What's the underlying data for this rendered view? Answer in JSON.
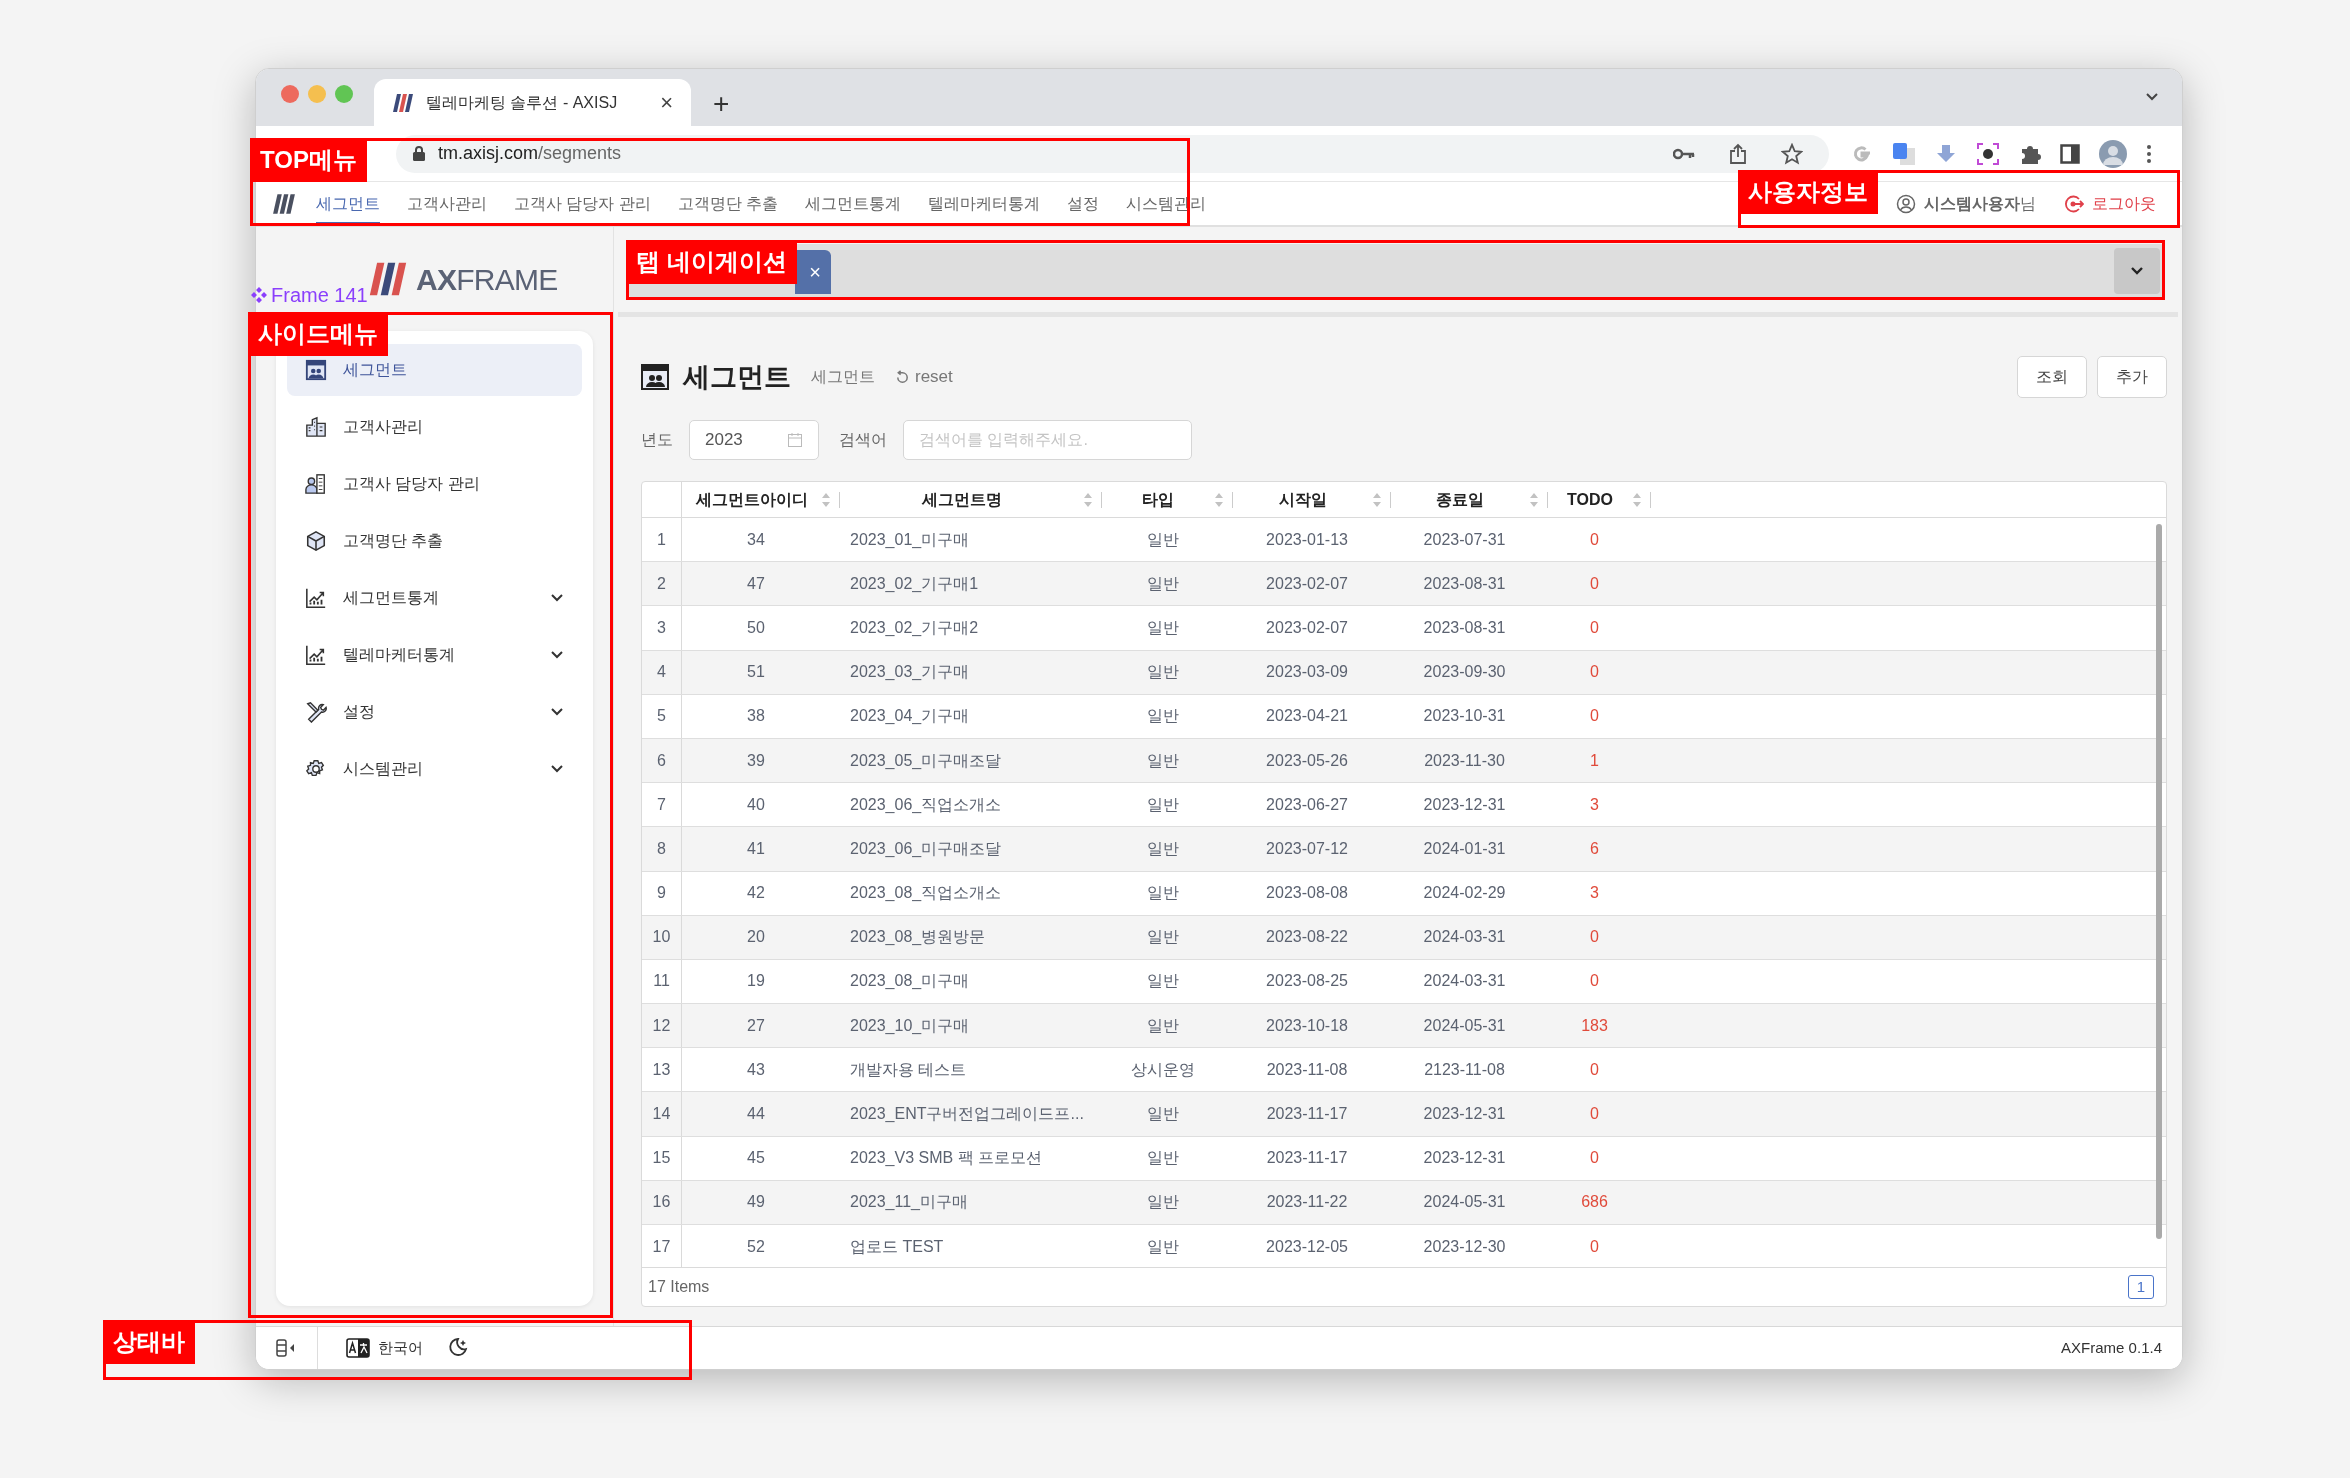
{
  "browser": {
    "tab_title": "텔레마케팅 솔루션 - AXISJ",
    "tab_close": "×",
    "new_tab": "+",
    "url_host": "tm.axisj.com",
    "url_path": "/segments"
  },
  "top_menu": [
    {
      "label": "세그먼트",
      "selected": true
    },
    {
      "label": "고객사관리",
      "selected": false
    },
    {
      "label": "고객사 담당자 관리",
      "selected": false
    },
    {
      "label": "고객명단 추출",
      "selected": false
    },
    {
      "label": "세그먼트통계",
      "selected": false
    },
    {
      "label": "텔레마케터통계",
      "selected": false
    },
    {
      "label": "설정",
      "selected": false
    },
    {
      "label": "시스템관리",
      "selected": false
    }
  ],
  "user": {
    "name": "**시스템사용자**님",
    "logout": "로그아웃"
  },
  "frame_label": "Frame 141",
  "logo": "**AX**FRAME",
  "sidebar": {
    "items": [
      {
        "label": "세그먼트",
        "selected": true,
        "has_submenu": false
      },
      {
        "label": "고객사관리",
        "selected": false,
        "has_submenu": false
      },
      {
        "label": "고객사 담당자 관리",
        "selected": false,
        "has_submenu": false
      },
      {
        "label": "고객명단 추출",
        "selected": false,
        "has_submenu": false
      },
      {
        "label": "세그먼트통계",
        "selected": false,
        "has_submenu": true
      },
      {
        "label": "텔레마케터통계",
        "selected": false,
        "has_submenu": true
      },
      {
        "label": "설정",
        "selected": false,
        "has_submenu": true
      },
      {
        "label": "시스템관리",
        "selected": false,
        "has_submenu": true
      }
    ]
  },
  "tab_nav": {
    "tabs": [
      {
        "close": "×",
        "selected": true
      }
    ]
  },
  "page": {
    "title": "세그먼트",
    "breadcrumb": "세그먼트",
    "reset": "reset",
    "buttons": [
      "조회",
      "추가"
    ]
  },
  "filters": {
    "year_label": "년도",
    "year_value": "2023",
    "search_label": "검색어",
    "search_placeholder": "검색어를 입력해주세요."
  },
  "table": {
    "columns": [
      "세그먼트아이디",
      "세그먼트명",
      "타입",
      "시작일",
      "종료일",
      "TODO"
    ],
    "rows": [
      {
        "no": "1",
        "id": "34",
        "name": "2023_01_미구매",
        "type": "일반",
        "start": "2023-01-13",
        "end": "2023-07-31",
        "todo": "0"
      },
      {
        "no": "2",
        "id": "47",
        "name": "2023_02_기구매1",
        "type": "일반",
        "start": "2023-02-07",
        "end": "2023-08-31",
        "todo": "0"
      },
      {
        "no": "3",
        "id": "50",
        "name": "2023_02_기구매2",
        "type": "일반",
        "start": "2023-02-07",
        "end": "2023-08-31",
        "todo": "0"
      },
      {
        "no": "4",
        "id": "51",
        "name": "2023_03_기구매",
        "type": "일반",
        "start": "2023-03-09",
        "end": "2023-09-30",
        "todo": "0"
      },
      {
        "no": "5",
        "id": "38",
        "name": "2023_04_기구매",
        "type": "일반",
        "start": "2023-04-21",
        "end": "2023-10-31",
        "todo": "0"
      },
      {
        "no": "6",
        "id": "39",
        "name": "2023_05_미구매조달",
        "type": "일반",
        "start": "2023-05-26",
        "end": "2023-11-30",
        "todo": "1"
      },
      {
        "no": "7",
        "id": "40",
        "name": "2023_06_직업소개소",
        "type": "일반",
        "start": "2023-06-27",
        "end": "2023-12-31",
        "todo": "3"
      },
      {
        "no": "8",
        "id": "41",
        "name": "2023_06_미구매조달",
        "type": "일반",
        "start": "2023-07-12",
        "end": "2024-01-31",
        "todo": "6"
      },
      {
        "no": "9",
        "id": "42",
        "name": "2023_08_직업소개소",
        "type": "일반",
        "start": "2023-08-08",
        "end": "2024-02-29",
        "todo": "3"
      },
      {
        "no": "10",
        "id": "20",
        "name": "2023_08_병원방문",
        "type": "일반",
        "start": "2023-08-22",
        "end": "2024-03-31",
        "todo": "0"
      },
      {
        "no": "11",
        "id": "19",
        "name": "2023_08_미구매",
        "type": "일반",
        "start": "2023-08-25",
        "end": "2024-03-31",
        "todo": "0"
      },
      {
        "no": "12",
        "id": "27",
        "name": "2023_10_미구매",
        "type": "일반",
        "start": "2023-10-18",
        "end": "2024-05-31",
        "todo": "183"
      },
      {
        "no": "13",
        "id": "43",
        "name": "개발자용 테스트",
        "type": "상시운영",
        "start": "2023-11-08",
        "end": "2123-11-08",
        "todo": "0"
      },
      {
        "no": "14",
        "id": "44",
        "name": "2023_ENT구버전업그레이드프...",
        "type": "일반",
        "start": "2023-11-17",
        "end": "2023-12-31",
        "todo": "0"
      },
      {
        "no": "15",
        "id": "45",
        "name": "2023_V3 SMB 팩 프로모션",
        "type": "일반",
        "start": "2023-11-17",
        "end": "2023-12-31",
        "todo": "0"
      },
      {
        "no": "16",
        "id": "49",
        "name": "2023_11_미구매",
        "type": "일반",
        "start": "2023-11-22",
        "end": "2024-05-31",
        "todo": "686"
      },
      {
        "no": "17",
        "id": "52",
        "name": "업로드 TEST",
        "type": "일반",
        "start": "2023-12-05",
        "end": "2023-12-30",
        "todo": "0"
      }
    ],
    "footer": "17 Items",
    "page": "1"
  },
  "status_bar": {
    "language": "한국어",
    "version": "AXFrame 0.1.4"
  },
  "annotations": [
    {
      "label": "TOP메뉴"
    },
    {
      "label": "사용자정보"
    },
    {
      "label": "탭 네이게이션"
    },
    {
      "label": "사이드메뉴"
    },
    {
      "label": "상태바"
    }
  ]
}
